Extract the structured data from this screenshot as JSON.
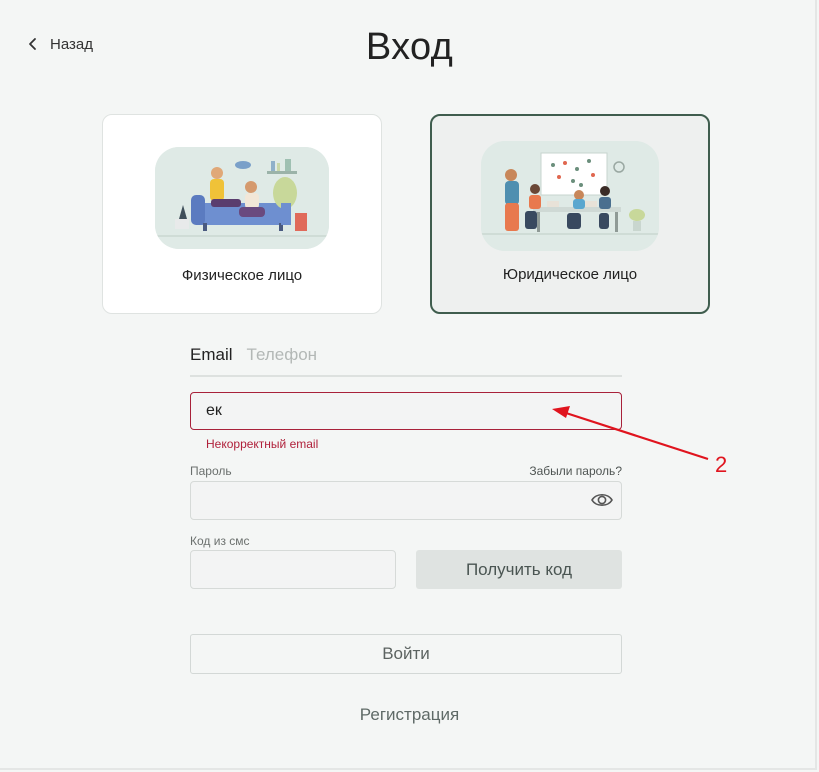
{
  "header": {
    "back_label": "Назад",
    "title": "Вход"
  },
  "account_types": [
    {
      "label": "Физическое лицо",
      "selected": false
    },
    {
      "label": "Юридическое лицо",
      "selected": true
    }
  ],
  "login_tabs": [
    {
      "label": "Email",
      "active": true
    },
    {
      "label": "Телефон",
      "active": false
    }
  ],
  "email_field": {
    "value": "ек",
    "error": "Некорректный email"
  },
  "password_field": {
    "label": "Пароль",
    "forgot_link": "Забыли пароль?",
    "value": ""
  },
  "sms_field": {
    "label": "Код из смс",
    "value": "",
    "get_code_button": "Получить код"
  },
  "login_button": "Войти",
  "register_link": "Регистрация",
  "annotation": {
    "number": "2",
    "color": "#e0141e"
  },
  "colors": {
    "accent": "#3f5d4e",
    "error": "#b0213b",
    "background": "#f4f6f5"
  }
}
